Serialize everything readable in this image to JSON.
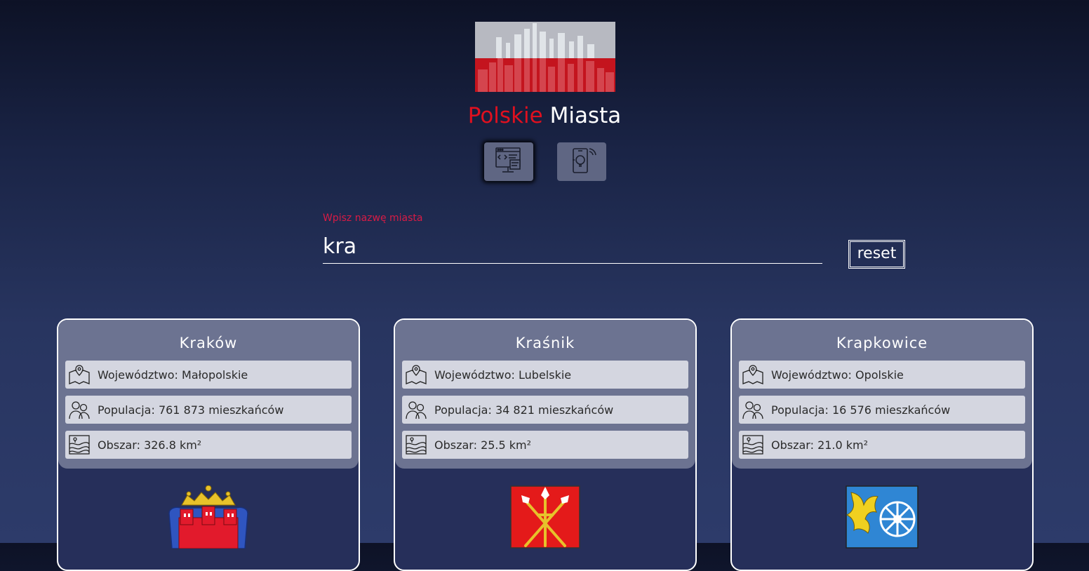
{
  "header": {
    "logo_icon": "poland-skyline-logo",
    "title_accent": "Polskie",
    "title_rest": "Miasta",
    "accent_color": "#e0101f"
  },
  "mode_buttons": [
    {
      "icon": "web-code-icon",
      "active": true
    },
    {
      "icon": "mobile-idea-icon",
      "active": false
    }
  ],
  "search": {
    "label": "Wpisz nazwę miasta",
    "value": "kra",
    "reset_label": "reset"
  },
  "cities": [
    {
      "name": "Kraków",
      "voivodeship": "Województwo: Małopolskie",
      "population": "Populacja: 761 873 mieszkańców",
      "area": "Obszar: 326.8 km²",
      "crest_icon": "krakow-coat-of-arms"
    },
    {
      "name": "Kraśnik",
      "voivodeship": "Województwo: Lubelskie",
      "population": "Populacja: 34 821 mieszkańców",
      "area": "Obszar: 25.5 km²",
      "crest_icon": "krasnik-coat-of-arms"
    },
    {
      "name": "Krapkowice",
      "voivodeship": "Województwo: Opolskie",
      "population": "Populacja: 16 576 mieszkańców",
      "area": "Obszar: 21.0 km²",
      "crest_icon": "krapkowice-coat-of-arms"
    }
  ]
}
